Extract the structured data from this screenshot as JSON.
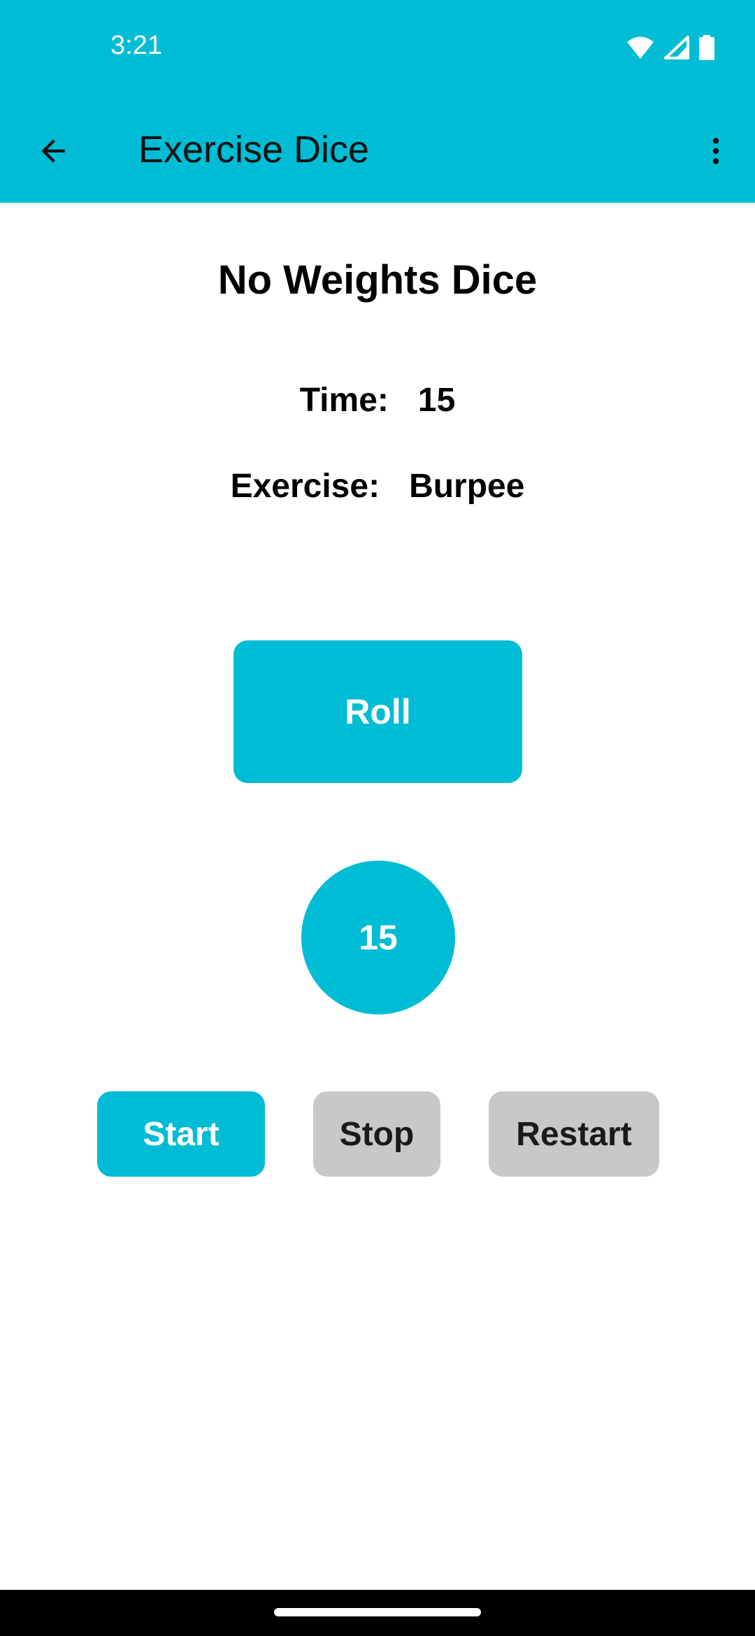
{
  "colors": {
    "accent": "#00BCD4",
    "button_inactive": "#C8C8C8",
    "background": "#FFFFFF",
    "nav_bar": "#000000"
  },
  "status_bar": {
    "time": "3:21",
    "icons": [
      "wifi-icon",
      "cellular-signal-icon",
      "battery-icon"
    ]
  },
  "app_bar": {
    "title": "Exercise Dice",
    "back_icon": "arrow-back-icon",
    "menu_icon": "more-vert-icon"
  },
  "main": {
    "title": "No Weights Dice",
    "time_label": "Time:",
    "time_value": "15",
    "exercise_label": "Exercise:",
    "exercise_value": "Burpee",
    "roll_label": "Roll",
    "dice_value": "15"
  },
  "controls": {
    "start_label": "Start",
    "stop_label": "Stop",
    "restart_label": "Restart"
  }
}
